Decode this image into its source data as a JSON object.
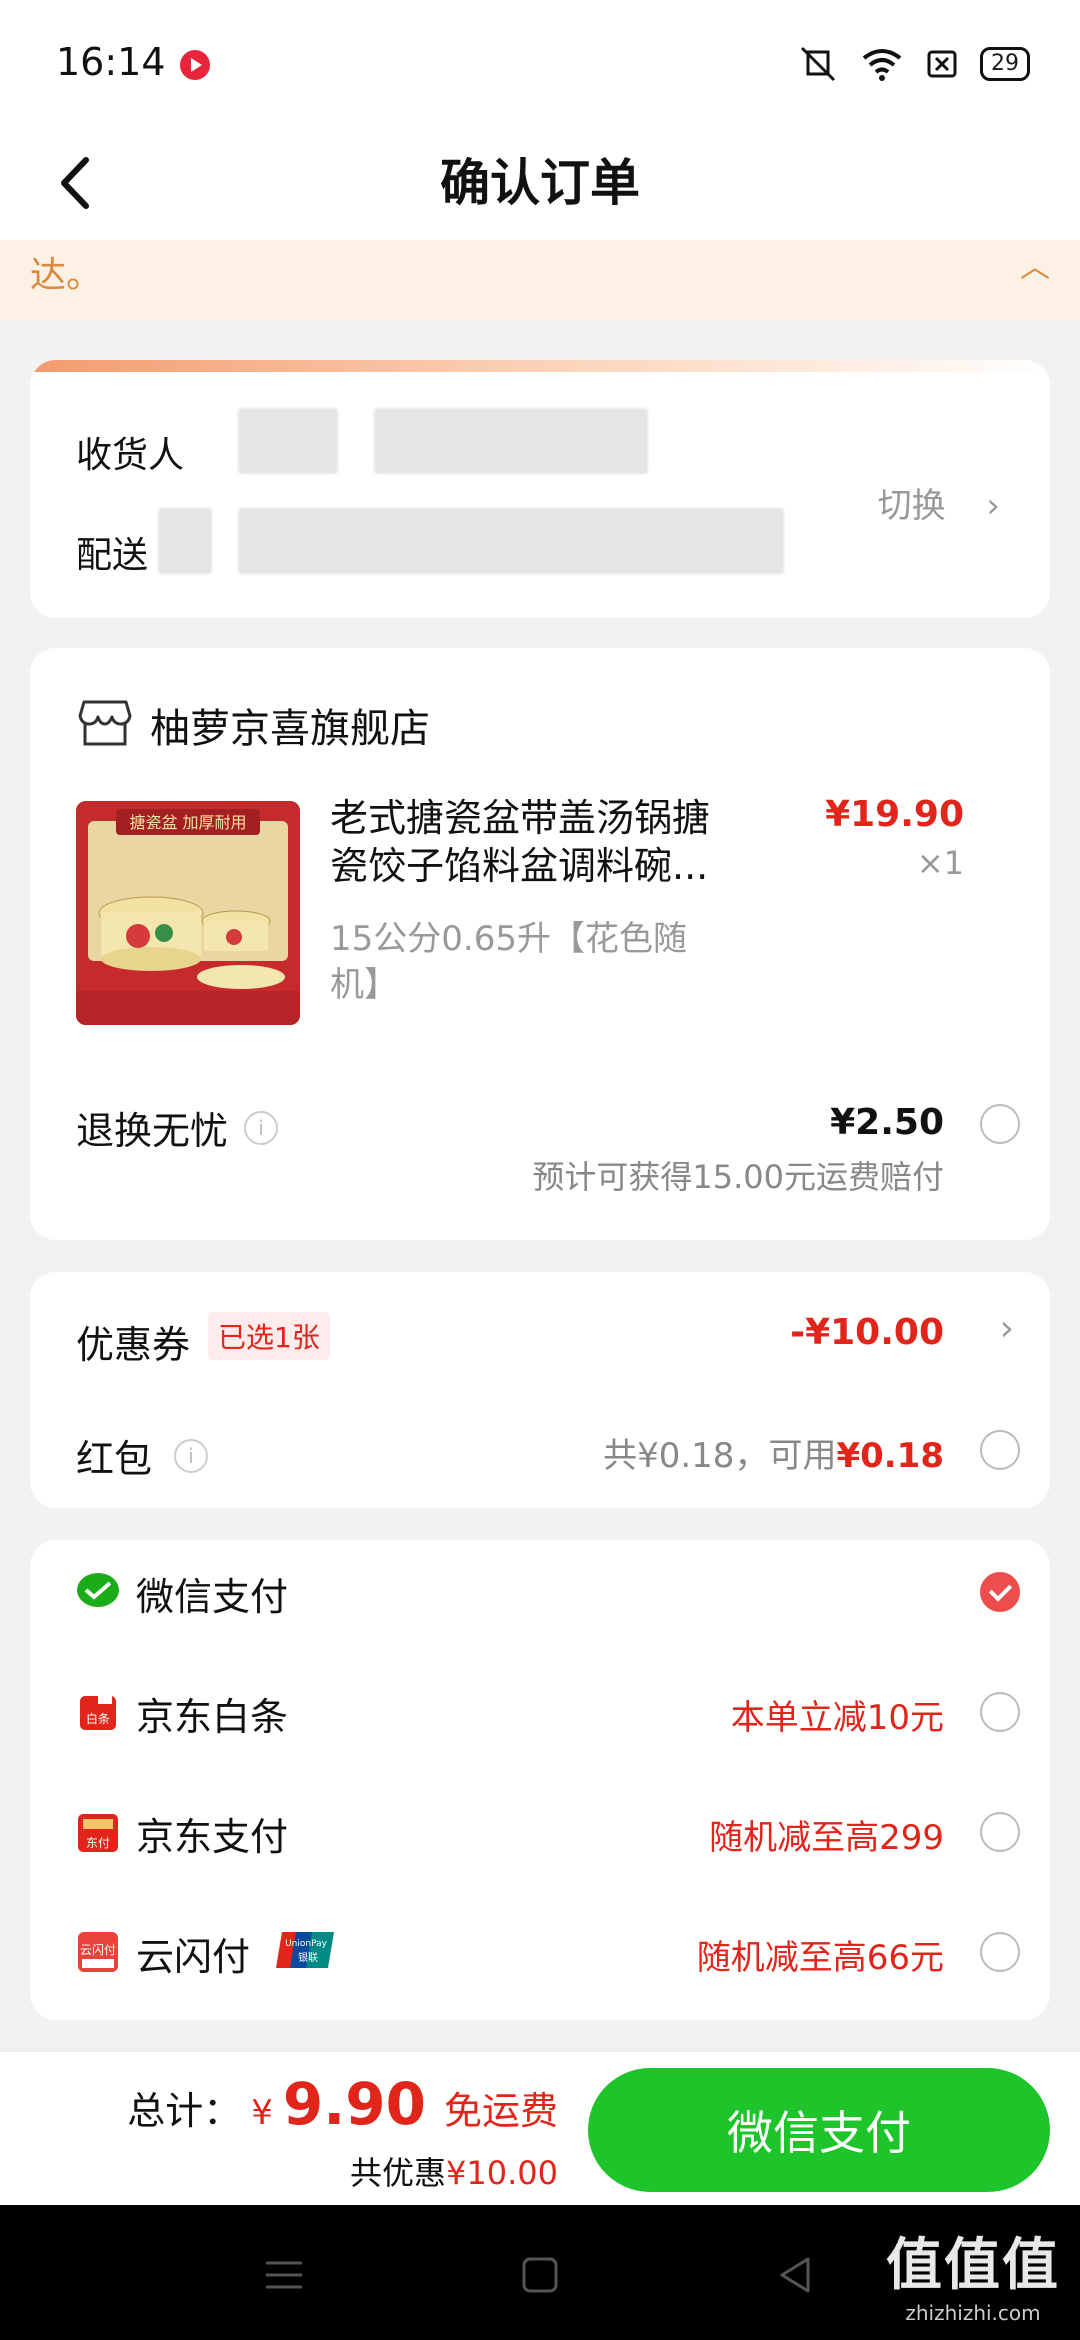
{
  "status": {
    "time": "16:14",
    "battery": "29"
  },
  "header": {
    "title": "确认订单"
  },
  "notice": {
    "text": "达。"
  },
  "address": {
    "recipient_label": "收货人",
    "delivery_label": "配送",
    "switch_label": "切换"
  },
  "shop": {
    "name": "柚萝京喜旗舰店",
    "product": {
      "title": "老式搪瓷盆带盖汤锅搪瓷饺子馅料盆调料碗...",
      "spec": "15公分0.65升【花色随机】",
      "price": "¥19.90",
      "qty": "×1",
      "image_banner": "搪瓷盆 加厚耐用"
    },
    "service": {
      "label": "退换无忧",
      "price": "¥2.50",
      "note": "预计可获得15.00元运费赔付",
      "checked": false
    }
  },
  "discounts": {
    "coupon": {
      "label": "优惠券",
      "badge": "已选1张",
      "amount": "-¥10.00"
    },
    "redpacket": {
      "label": "红包",
      "total": "共¥0.18，可用",
      "available": "¥0.18",
      "checked": false
    }
  },
  "payment_methods": [
    {
      "label": "微信支付",
      "promo": "",
      "icon": "wechat-pay-icon",
      "color": "#1aad19",
      "checked": true
    },
    {
      "label": "京东白条",
      "promo": "本单立减10元",
      "icon": "jd-baitiao-icon",
      "color": "#e1251b",
      "checked": false
    },
    {
      "label": "京东支付",
      "promo": "随机减至高299",
      "icon": "jd-pay-icon",
      "color": "#e1251b",
      "checked": false
    },
    {
      "label": "云闪付",
      "promo": "随机减至高66元",
      "icon": "cloud-quickpass-icon",
      "color": "#e1251b",
      "checked": false
    }
  ],
  "unionpay_badge": {
    "line1": "UnionPay",
    "line2": "银联"
  },
  "footer": {
    "total_label": "总计：",
    "currency": "¥",
    "total_amount": "9.90",
    "shipping": "免运费",
    "saved_label": "共优惠",
    "saved_amount": "¥10.00",
    "pay_button": "微信支付"
  },
  "watermark": {
    "big": "值值值",
    "small": "zhizhizhi.com"
  }
}
